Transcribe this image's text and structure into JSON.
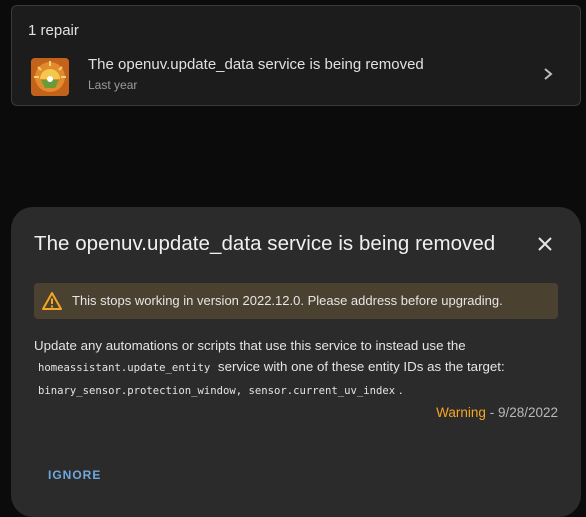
{
  "repairs": {
    "header": "1 repair",
    "items": [
      {
        "title": "The openuv.update_data service is being removed",
        "subtitle": "Last year",
        "icon": "openuv-logo-icon"
      }
    ]
  },
  "dialog": {
    "title": "The openuv.update_data service is being removed",
    "warning": "This stops working in version 2022.12.0. Please address before upgrading.",
    "body": {
      "line1": "Update any automations or scripts that use this service to instead use the",
      "code1": "homeassistant.update_entity",
      "line2": "service with one of these entity IDs as the target:",
      "code2": "binary_sensor.protection_window, sensor.current_uv_index",
      "end": "."
    },
    "severity": "Warning",
    "separator": " - ",
    "date": "9/28/2022",
    "ignore_label": "IGNORE"
  },
  "colors": {
    "severity": "#f5a623",
    "accent": "#6fa8dc",
    "warning_bg": "#4a4131"
  }
}
